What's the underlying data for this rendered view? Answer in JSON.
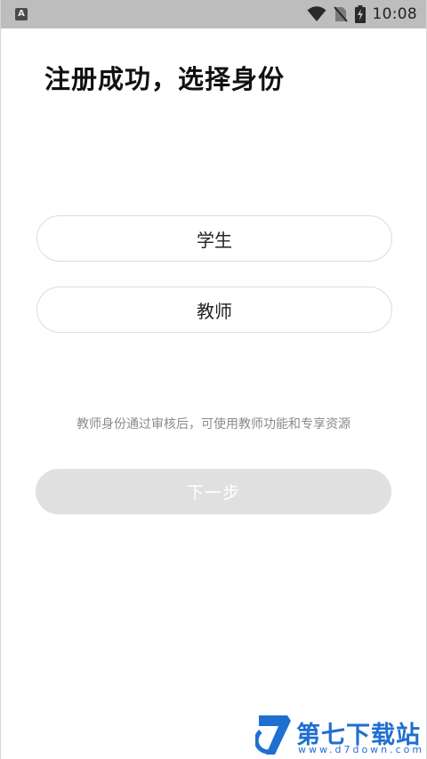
{
  "status_bar": {
    "app_icon_letter": "A",
    "time": "10:08",
    "icons": [
      "wifi-icon",
      "no-sim-icon",
      "battery-charging-icon"
    ]
  },
  "page": {
    "title": "注册成功，选择身份"
  },
  "roles": [
    {
      "label": "学生"
    },
    {
      "label": "教师"
    }
  ],
  "hint": "教师身份通过审核后，可使用教师功能和专享资源",
  "next_button": {
    "label": "下一步",
    "enabled": false
  },
  "watermark": {
    "name": "第七下载站",
    "url": "www.d7down.com"
  },
  "colors": {
    "status_bar_bg": "#bdbdbd",
    "button_disabled_bg": "#e0e0e0",
    "option_border": "#dcdcdc",
    "hint_text": "#8a8a8a",
    "watermark_blue": "#1f6fd0"
  }
}
